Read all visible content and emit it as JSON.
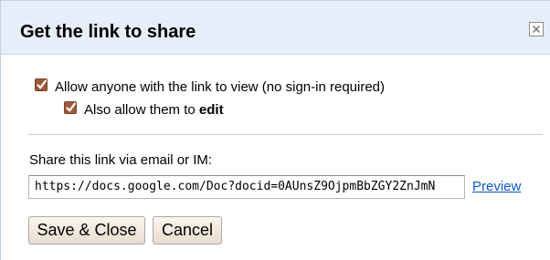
{
  "dialog": {
    "title": "Get the link to share",
    "close_icon": "close-x-icon"
  },
  "options": {
    "allow_view": {
      "label": "Allow anyone with the link to view (no sign-in required)",
      "checked": true
    },
    "allow_edit": {
      "label_prefix": "Also allow them to ",
      "label_emphasis": "edit",
      "checked": true
    }
  },
  "share": {
    "label": "Share this link via email or IM:",
    "link_value": "https://docs.google.com/Doc?docid=0AUnsZ9OjpmBbZGY2ZnJmN",
    "preview_label": "Preview"
  },
  "actions": {
    "save_label": "Save & Close",
    "cancel_label": "Cancel"
  },
  "colors": {
    "titlebar_bg": "#e6eef9",
    "checkbox_fill": "#9b5a3c",
    "link": "#1155cc"
  }
}
